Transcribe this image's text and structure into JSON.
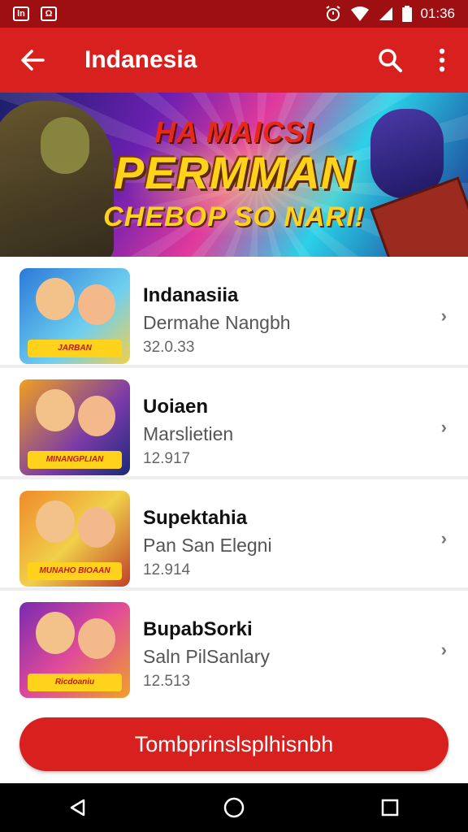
{
  "status_bar": {
    "time": "01:36",
    "left_icons": [
      "ln-notification-icon",
      "shield-notification-icon"
    ],
    "right_icons": [
      "alarm-icon",
      "wifi-icon",
      "cellular-icon",
      "battery-icon"
    ],
    "left_icon_text": [
      "ln",
      "Ω"
    ]
  },
  "app_bar": {
    "title": "Indanesia",
    "back_icon": "arrow-left-icon",
    "search_icon": "search-icon",
    "more_icon": "more-vertical-icon"
  },
  "banner": {
    "line1": "HA MAICSI",
    "line2": "PERMMAN",
    "line3": "CHEBOP SO NARI!"
  },
  "apps": [
    {
      "name": "Indanasiia",
      "subtitle": "Dermahe Nangbh",
      "meta": "32.0.33",
      "badge": "JARBAN"
    },
    {
      "name": "Uoiaen",
      "subtitle": "Marslietien",
      "meta": "12.917",
      "badge": "MINANGPLIAN"
    },
    {
      "name": "Supektahia",
      "subtitle": "Pan San Elegni",
      "meta": "12.914",
      "badge": "MUNAHO BIOAAN"
    },
    {
      "name": "BupabSorki",
      "subtitle": "Saln PilSanlary",
      "meta": "12.513",
      "badge": "Ricdoaniu"
    }
  ],
  "cta": {
    "label": "Tombprinslsplhisnbh"
  },
  "nav": {
    "icons": [
      "back-triangle-icon",
      "home-circle-icon",
      "recents-square-icon"
    ]
  },
  "colors": {
    "primary": "#d8201f",
    "status": "#9e0f12",
    "navbar": "#000000"
  }
}
